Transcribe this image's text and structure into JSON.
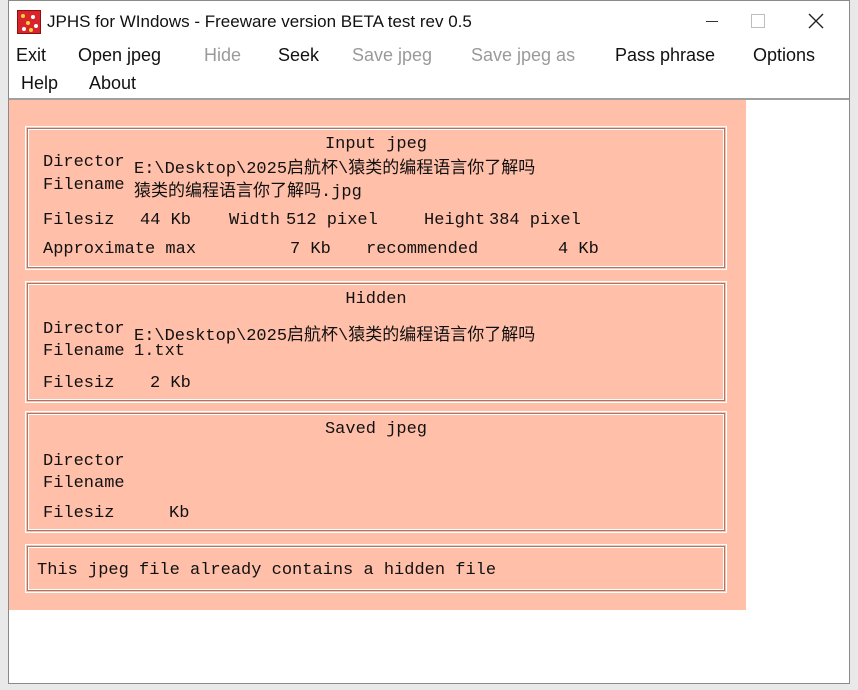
{
  "window": {
    "title": "JPHS for WIndows - Freeware version BETA test rev 0.5",
    "icon": "jphs-app-icon"
  },
  "menu": {
    "row1": [
      {
        "label": "Exit",
        "enabled": true
      },
      {
        "label": "Open jpeg",
        "enabled": true
      },
      {
        "label": "Hide",
        "enabled": false
      },
      {
        "label": "Seek",
        "enabled": true
      },
      {
        "label": "Save jpeg",
        "enabled": false
      },
      {
        "label": "Save jpeg as",
        "enabled": false
      },
      {
        "label": "Pass phrase",
        "enabled": true
      },
      {
        "label": "Options",
        "enabled": true
      }
    ],
    "row2": [
      {
        "label": "Help",
        "enabled": true
      },
      {
        "label": "About",
        "enabled": true
      }
    ]
  },
  "input_jpeg": {
    "heading": "Input jpeg",
    "directory_label": "Directory",
    "directory_value": "E:\\Desktop\\2025启航杯\\猿类的编程语言你了解吗",
    "filename_label": "Filename",
    "filename_value": "猿类的编程语言你了解吗.jpg",
    "filesize_label": "Filesize",
    "filesize_value": "44 Kb",
    "width_label": "Width",
    "width_value": "512 pixel",
    "height_label": "Height",
    "height_value": "384 pixel",
    "approx_label": "Approximate max",
    "approx_value": "7 Kb",
    "recommended_label": "recommended",
    "recommended_value": "4 Kb"
  },
  "hidden": {
    "heading": "Hidden",
    "directory_label": "Directory",
    "directory_value": "E:\\Desktop\\2025启航杯\\猿类的编程语言你了解吗",
    "filename_label": "Filename",
    "filename_value": "1.txt",
    "filesize_label": "Filesize",
    "filesize_value": "2 Kb"
  },
  "saved_jpeg": {
    "heading": "Saved jpeg",
    "directory_label": "Directory",
    "filename_label": "Filename",
    "filesize_label": "Filesize",
    "filesize_value": "Kb"
  },
  "status": {
    "message": "This jpeg file already contains a hidden file"
  },
  "colors": {
    "panel_background": "#ffbfa9",
    "window_background": "#ffffff"
  }
}
